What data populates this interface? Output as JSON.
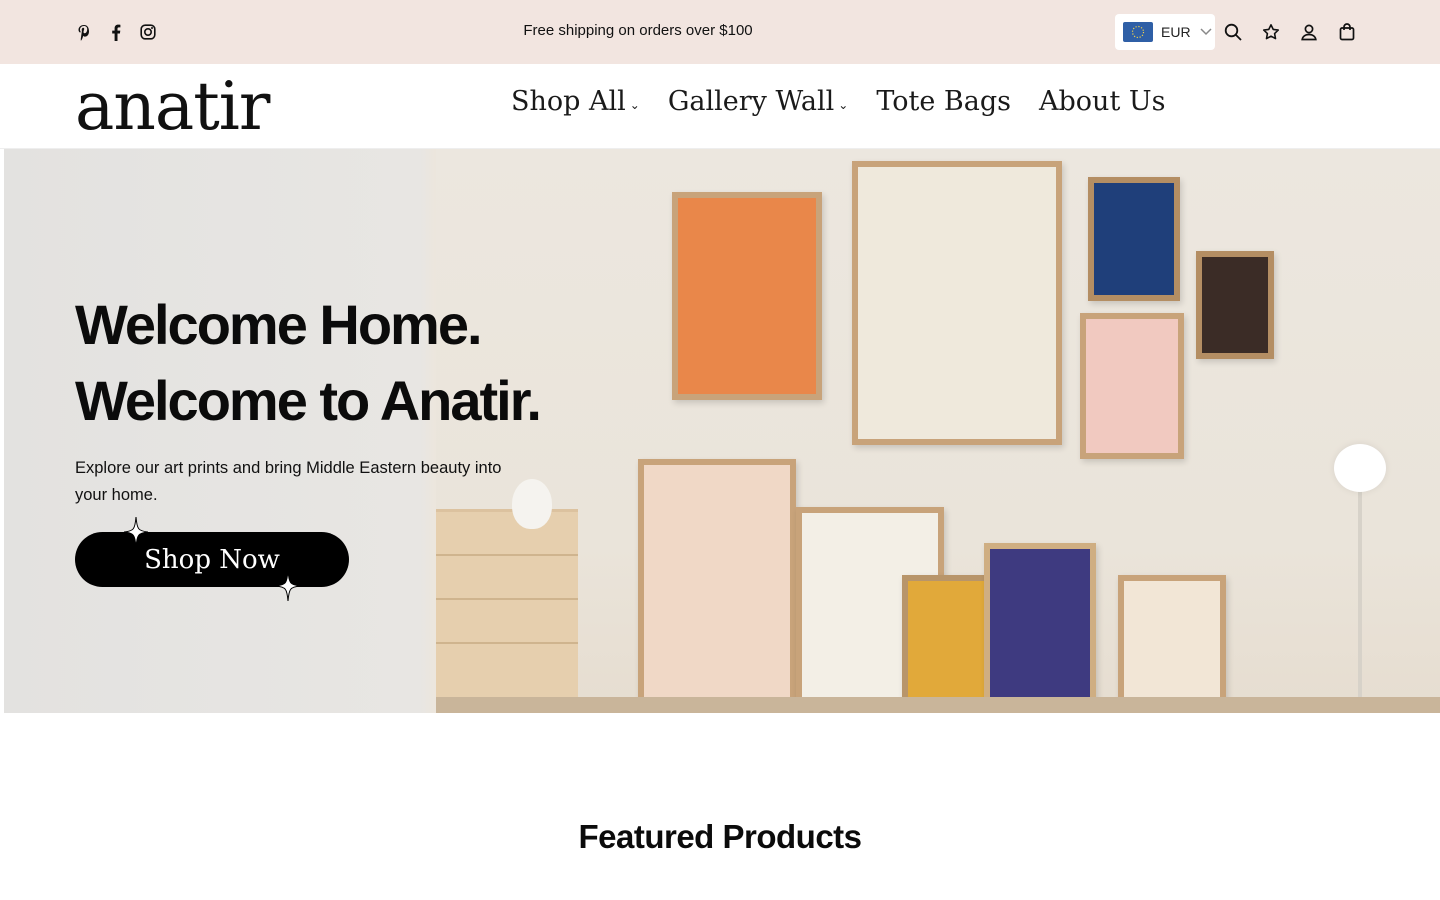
{
  "topbar": {
    "social": [
      {
        "icon": "pinterest-icon"
      },
      {
        "icon": "facebook-icon"
      },
      {
        "icon": "instagram-icon"
      }
    ],
    "announcement": "Free shipping on orders over $100",
    "currency": {
      "code": "EUR",
      "flag_icon": "eu-flag-icon"
    },
    "icons": [
      "search-icon",
      "wishlist-star-icon",
      "account-icon",
      "cart-bag-icon"
    ]
  },
  "header": {
    "logo": "anatir",
    "nav": [
      {
        "label": "Shop All",
        "dropdown": true
      },
      {
        "label": "Gallery Wall",
        "dropdown": true
      },
      {
        "label": "Tote Bags",
        "dropdown": false
      },
      {
        "label": "About Us",
        "dropdown": false
      }
    ]
  },
  "hero": {
    "title_line1": "Welcome Home.",
    "title_line2": "Welcome to Anatir.",
    "text": "Explore our art prints and bring Middle Eastern beauty into your home.",
    "button": "Shop Now"
  },
  "featured": {
    "title": "Featured Products"
  },
  "colors": {
    "topbar_bg": "#f2e5e0",
    "button_bg": "#000000",
    "text": "#0b0b0b",
    "frame_wood": "#c8a37a"
  }
}
